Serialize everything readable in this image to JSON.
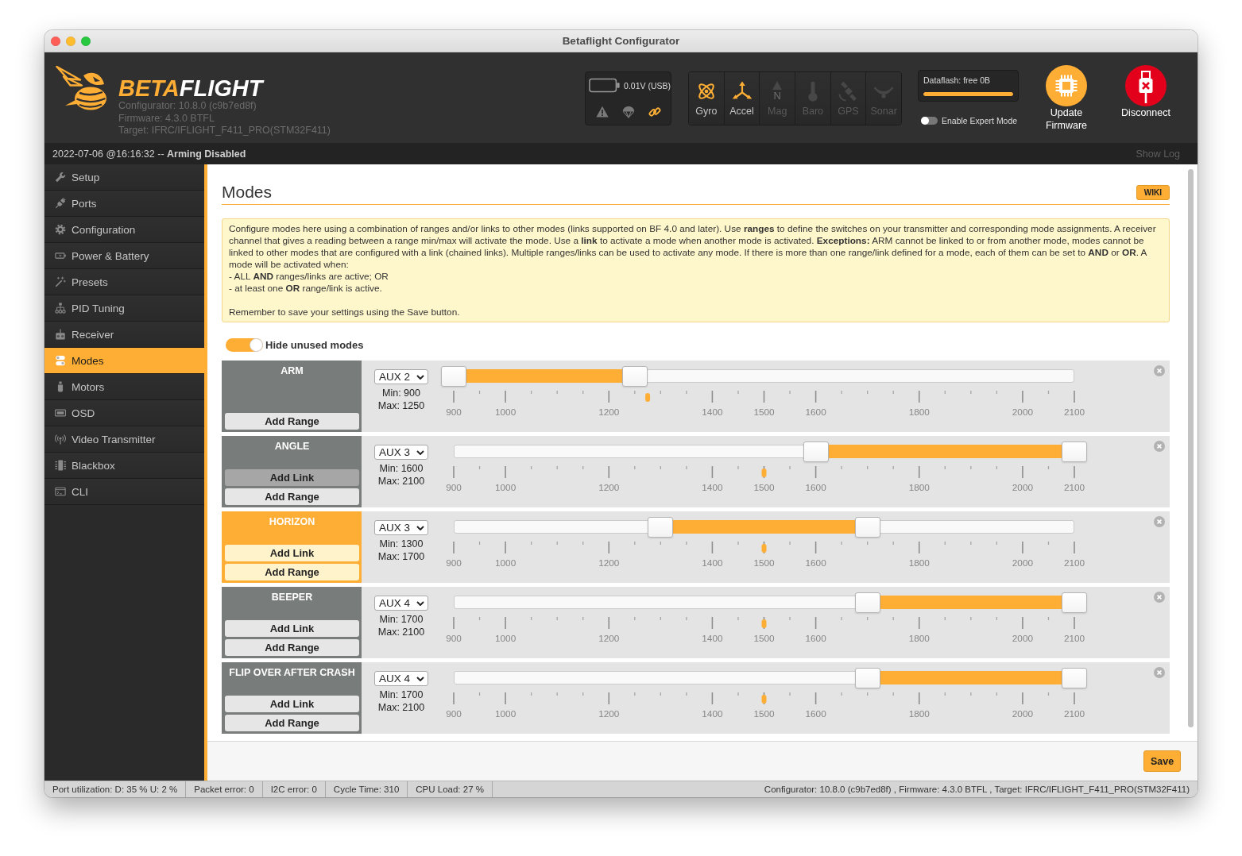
{
  "window": {
    "title": "Betaflight Configurator"
  },
  "header": {
    "brand": {
      "accent": "BETA",
      "rest": "FLIGHT"
    },
    "versions": [
      "Configurator: 10.8.0 (c9b7ed8f)",
      "Firmware: 4.3.0 BTFL",
      "Target: IFRC/IFLIGHT_F411_PRO(STM32F411)"
    ],
    "battery_reading": "0.01V (USB)",
    "status_icons": [
      {
        "active": false
      },
      {
        "active": false
      },
      {
        "active": true
      }
    ],
    "sensors": [
      {
        "label": "Gyro",
        "active": true
      },
      {
        "label": "Accel",
        "active": true
      },
      {
        "label": "Mag",
        "active": false,
        "icon_letter": "N"
      },
      {
        "label": "Baro",
        "active": false
      },
      {
        "label": "GPS",
        "active": false
      },
      {
        "label": "Sonar",
        "active": false
      }
    ],
    "dataflash": {
      "label": "Dataflash: free 0B",
      "level": 1
    },
    "expert_mode": {
      "label": "Enable Expert Mode",
      "on": false
    },
    "actions": [
      {
        "kind": "firmware",
        "label": "Update Firmware"
      },
      {
        "kind": "disconnect",
        "label": "Disconnect"
      }
    ]
  },
  "log_bar": {
    "message": "2022-07-06 @16:16:32 -- **Arming Disabled**",
    "link": "Show Log"
  },
  "sidebar": {
    "items": [
      {
        "label": "Setup",
        "selected": false
      },
      {
        "label": "Ports",
        "selected": false
      },
      {
        "label": "Configuration",
        "selected": false
      },
      {
        "label": "Power & Battery",
        "selected": false
      },
      {
        "label": "Presets",
        "selected": false
      },
      {
        "label": "PID Tuning",
        "selected": false
      },
      {
        "label": "Receiver",
        "selected": false
      },
      {
        "label": "Modes",
        "selected": true
      },
      {
        "label": "Motors",
        "selected": false
      },
      {
        "label": "OSD",
        "selected": false
      },
      {
        "label": "Video Transmitter",
        "selected": false
      },
      {
        "label": "Blackbox",
        "selected": false
      },
      {
        "label": "CLI",
        "selected": false
      }
    ]
  },
  "content": {
    "title": "Modes",
    "wiki": "WIKI",
    "info": {
      "paragraph": "Configure modes here using a combination of ranges and/or links to other modes (links supported on BF 4.0 and later). Use **ranges** to define the switches on your transmitter and corresponding mode assignments. A receiver channel that gives a reading between a range min/max will activate the mode. Use a **link** to activate a mode when another mode is activated. **Exceptions:** ARM cannot be linked to or from another mode, modes cannot be linked to other modes that are configured with a link (chained links). Multiple ranges/links can be used to activate any mode. If there is more than one range/link defined for a mode, each of them can be set to **AND** or **OR**. A mode will be activated when:",
      "bullets": [
        "- ALL **AND** ranges/links are active; OR",
        "- at least one **OR** range/link is active."
      ],
      "note": "Remember to save your settings using the Save button."
    },
    "hide_unused": {
      "label": "Hide unused modes",
      "on": true
    },
    "modes": [
      {
        "name": "ARM",
        "active": false,
        "buttons": [
          {
            "label": "Add Range",
            "hovered": false
          }
        ],
        "channel": "AUX 2",
        "min": "Min: 900",
        "max": "Max: 1250",
        "handles": [
          {
            "level": 0
          },
          {
            "level": 0.2917
          }
        ],
        "marker": {
          "level": 0.3125
        },
        "scale": [
          "900",
          "1000",
          "1200",
          "1400",
          "1500",
          "1600",
          "1800",
          "2000",
          "2100"
        ]
      },
      {
        "name": "ANGLE",
        "active": false,
        "buttons": [
          {
            "label": "Add Link",
            "hovered": true
          },
          {
            "label": "Add Range",
            "hovered": false
          }
        ],
        "channel": "AUX 3",
        "min": "Min: 1600",
        "max": "Max: 2100",
        "handles": [
          {
            "level": 0.5833
          },
          {
            "level": 1
          }
        ],
        "marker": {
          "level": 0.5
        },
        "scale": [
          "900",
          "1000",
          "1200",
          "1400",
          "1500",
          "1600",
          "1800",
          "2000",
          "2100"
        ]
      },
      {
        "name": "HORIZON",
        "active": true,
        "buttons": [
          {
            "label": "Add Link",
            "hovered": false
          },
          {
            "label": "Add Range",
            "hovered": false
          }
        ],
        "channel": "AUX 3",
        "min": "Min: 1300",
        "max": "Max: 1700",
        "handles": [
          {
            "level": 0.3333
          },
          {
            "level": 0.6667
          }
        ],
        "marker": {
          "level": 0.5
        },
        "scale": [
          "900",
          "1000",
          "1200",
          "1400",
          "1500",
          "1600",
          "1800",
          "2000",
          "2100"
        ]
      },
      {
        "name": "BEEPER",
        "active": false,
        "buttons": [
          {
            "label": "Add Link",
            "hovered": false
          },
          {
            "label": "Add Range",
            "hovered": false
          }
        ],
        "channel": "AUX 4",
        "min": "Min: 1700",
        "max": "Max: 2100",
        "handles": [
          {
            "level": 0.6667
          },
          {
            "level": 1
          }
        ],
        "marker": {
          "level": 0.5
        },
        "scale": [
          "900",
          "1000",
          "1200",
          "1400",
          "1500",
          "1600",
          "1800",
          "2000",
          "2100"
        ]
      },
      {
        "name": "FLIP OVER AFTER CRASH",
        "active": false,
        "buttons": [
          {
            "label": "Add Link",
            "hovered": false
          },
          {
            "label": "Add Range",
            "hovered": false
          }
        ],
        "channel": "AUX 4",
        "min": "Min: 1700",
        "max": "Max: 2100",
        "handles": [
          {
            "level": 0.6667
          },
          {
            "level": 1
          }
        ],
        "marker": {
          "level": 0.5
        },
        "scale": [
          "900",
          "1000",
          "1200",
          "1400",
          "1500",
          "1600",
          "1800",
          "2000",
          "2100"
        ]
      }
    ],
    "save": "Save"
  },
  "status_bar": {
    "items": [
      "Port utilization: D: 35 % U: 2 %",
      "Packet error: 0",
      "I2C error: 0",
      "Cycle Time: 310",
      "CPU Load: 27 %"
    ],
    "version": "Configurator: 10.8.0 (c9b7ed8f) , Firmware: 4.3.0 BTFL , Target: IFRC/IFLIGHT_F411_PRO(STM32F411)"
  }
}
